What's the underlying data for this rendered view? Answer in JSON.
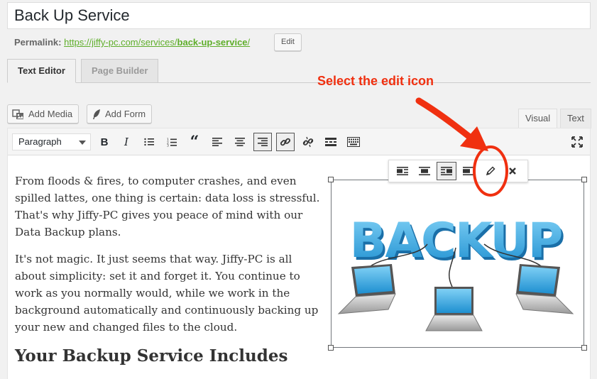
{
  "post": {
    "title": "Back Up Service"
  },
  "permalink": {
    "label": "Permalink:",
    "url_prefix": "https://jiffy-pc.com/services/",
    "url_slug": "back-up-service",
    "url_suffix": "/",
    "edit_label": "Edit"
  },
  "builder_tabs": [
    {
      "label": "Text Editor",
      "active": true
    },
    {
      "label": "Page Builder",
      "active": false
    }
  ],
  "media_buttons": {
    "add_media": "Add Media",
    "add_form": "Add Form"
  },
  "editor_tabs": {
    "visual": "Visual",
    "text": "Text"
  },
  "toolbar": {
    "format_select": "Paragraph",
    "buttons": [
      "bold-icon",
      "italic-icon",
      "bullet-list-icon",
      "numbered-list-icon",
      "blockquote-icon",
      "align-left-icon",
      "align-center-icon",
      "align-right-icon",
      "insert-link-icon",
      "remove-link-icon",
      "read-more-icon",
      "toolbar-toggle-icon",
      "fullscreen-icon"
    ],
    "bold_label": "B",
    "italic_label": "I",
    "quote_label": "“"
  },
  "image_toolbar": {
    "buttons": [
      "align-left-icon",
      "align-center-icon",
      "align-right-icon",
      "align-none-icon",
      "edit-pencil-icon",
      "remove-icon"
    ],
    "active": "align-right-icon"
  },
  "content": {
    "paragraphs": [
      "From floods & fires, to computer crashes, and even spilled lattes, one thing is certain: data loss is stressful. That's why Jiffy-PC gives you peace of mind with our Data Backup plans.",
      "It's not magic. It just seems that way. Jiffy-PC is all about simplicity: set it and forget it. You continue to work as you normally would, while we work in the background automatically and continuously backing up your new and changed files to the cloud."
    ],
    "heading": "Your Backup Service Includes"
  },
  "image": {
    "word": "BACKUP"
  },
  "annotation": {
    "text": "Select the edit icon",
    "color": "#f03010"
  },
  "colors": {
    "link_green": "#5fae2b",
    "annotation_red": "#f03010",
    "backup_blue": "#3fa9e0"
  }
}
